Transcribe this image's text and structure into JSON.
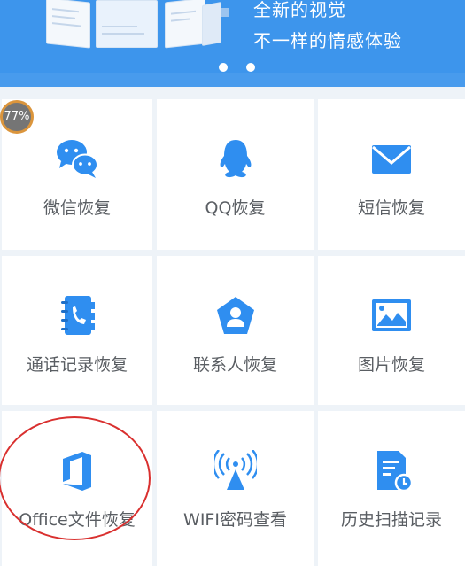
{
  "banner": {
    "slogan_line1": "全新的视觉",
    "slogan_line2": "不一样的情感体验",
    "background_color": "#3d95ec",
    "page_indicators": 2
  },
  "memory_badge": {
    "value": "77%"
  },
  "menu": {
    "accent_color": "#2f8ef0",
    "items": [
      {
        "label": "微信恢复",
        "icon": "wechat-icon"
      },
      {
        "label": "QQ恢复",
        "icon": "qq-penguin-icon"
      },
      {
        "label": "短信恢复",
        "icon": "envelope-icon"
      },
      {
        "label": "通话记录恢复",
        "icon": "phonebook-icon"
      },
      {
        "label": "联系人恢复",
        "icon": "contact-person-icon"
      },
      {
        "label": "图片恢复",
        "icon": "picture-icon"
      },
      {
        "label": "Office文件恢复",
        "icon": "office-icon"
      },
      {
        "label": "WIFI密码查看",
        "icon": "wifi-signal-icon"
      },
      {
        "label": "历史扫描记录",
        "icon": "document-history-icon"
      }
    ]
  },
  "annotation": {
    "highlight_color": "#d9302f",
    "highlighted_item": "Office文件恢复"
  }
}
